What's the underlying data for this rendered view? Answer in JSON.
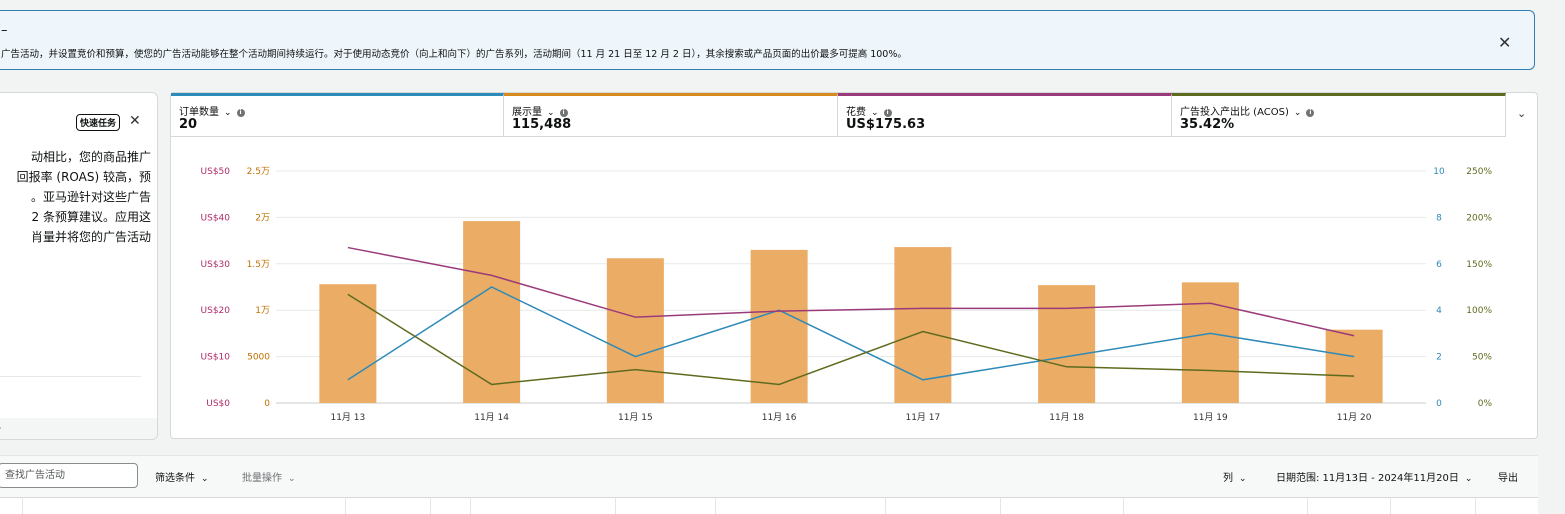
{
  "banner": {
    "dash": "–",
    "text": "广告活动，并设置竞价和预算，使您的广告活动能够在整个活动期间持续运行。对于使用动态竞价（向上和向下）的广告系列，活动期间（11 月 21 日至 12 月 2 日），其余搜索或产品页面的出价最多可提高 100%。",
    "close_icon": "close-icon"
  },
  "quick_task": {
    "badge": "快速任务",
    "lines": [
      "动相比，您的商品推广",
      "回报率 (ROAS) 较高，预",
      "。亚马逊针对这些广告",
      "2 条预算建议。应用这",
      "肖量并将您的广告活动"
    ]
  },
  "metrics": [
    {
      "label": "订单数量",
      "value": "20",
      "color": "#2e8ab8"
    },
    {
      "label": "展示量",
      "value": "115,488",
      "color": "#d98a1f"
    },
    {
      "label": "花费",
      "value": "US$175.63",
      "color": "#9b3a7a"
    },
    {
      "label": "广告投入产出比 (ACOS)",
      "value": "35.42%",
      "color": "#5d6b1e"
    }
  ],
  "chart_data": {
    "type": "bar",
    "categories": [
      "11月 13",
      "11月 14",
      "11月 15",
      "11月 16",
      "11月 17",
      "11月 18",
      "11月 19",
      "11月 20"
    ],
    "series": [
      {
        "values": [
          12800,
          19600,
          15600,
          16500,
          16800,
          12700,
          13000,
          7900
        ],
        "type": "bar",
        "axis": "impressions",
        "color": "#ebac65"
      },
      {
        "values": [
          1,
          5,
          2,
          4,
          1,
          2,
          3,
          2
        ],
        "type": "line",
        "axis": "orders",
        "color": "#2e8ab8"
      },
      {
        "values": [
          33.5,
          27.5,
          18.5,
          19.8,
          20.4,
          20.4,
          21.5,
          14.5
        ],
        "type": "line",
        "axis": "spend",
        "color": "#9b3a7a"
      },
      {
        "values": [
          117,
          20,
          36,
          20,
          77,
          39,
          35,
          29
        ],
        "type": "line",
        "axis": "acos",
        "color": "#5d6b1e"
      }
    ],
    "axes": {
      "spend": {
        "ticks": [
          "US$0",
          "US$10",
          "US$20",
          "US$30",
          "US$40",
          "US$50"
        ],
        "range": [
          0,
          50
        ],
        "color": "#b02a6a"
      },
      "impressions": {
        "ticks": [
          "0",
          "5000",
          "1万",
          "1.5万",
          "2万",
          "2.5万"
        ],
        "range": [
          0,
          25000
        ],
        "color": "#c26f00"
      },
      "orders": {
        "ticks": [
          "0",
          "2",
          "4",
          "6",
          "8",
          "10"
        ],
        "range": [
          0,
          10
        ],
        "color": "#2e8ab8"
      },
      "acos": {
        "ticks": [
          "0%",
          "50%",
          "100%",
          "150%",
          "200%",
          "250%"
        ],
        "range": [
          0,
          250
        ],
        "color": "#5d6b1e"
      }
    },
    "grid": true
  },
  "toolbar": {
    "search_placeholder": "查找广告活动",
    "filter": "筛选条件",
    "bulk": "批量操作",
    "columns": "列",
    "date_range": "日期范围: 11月13日 - 2024年11月20日",
    "export": "导出"
  }
}
